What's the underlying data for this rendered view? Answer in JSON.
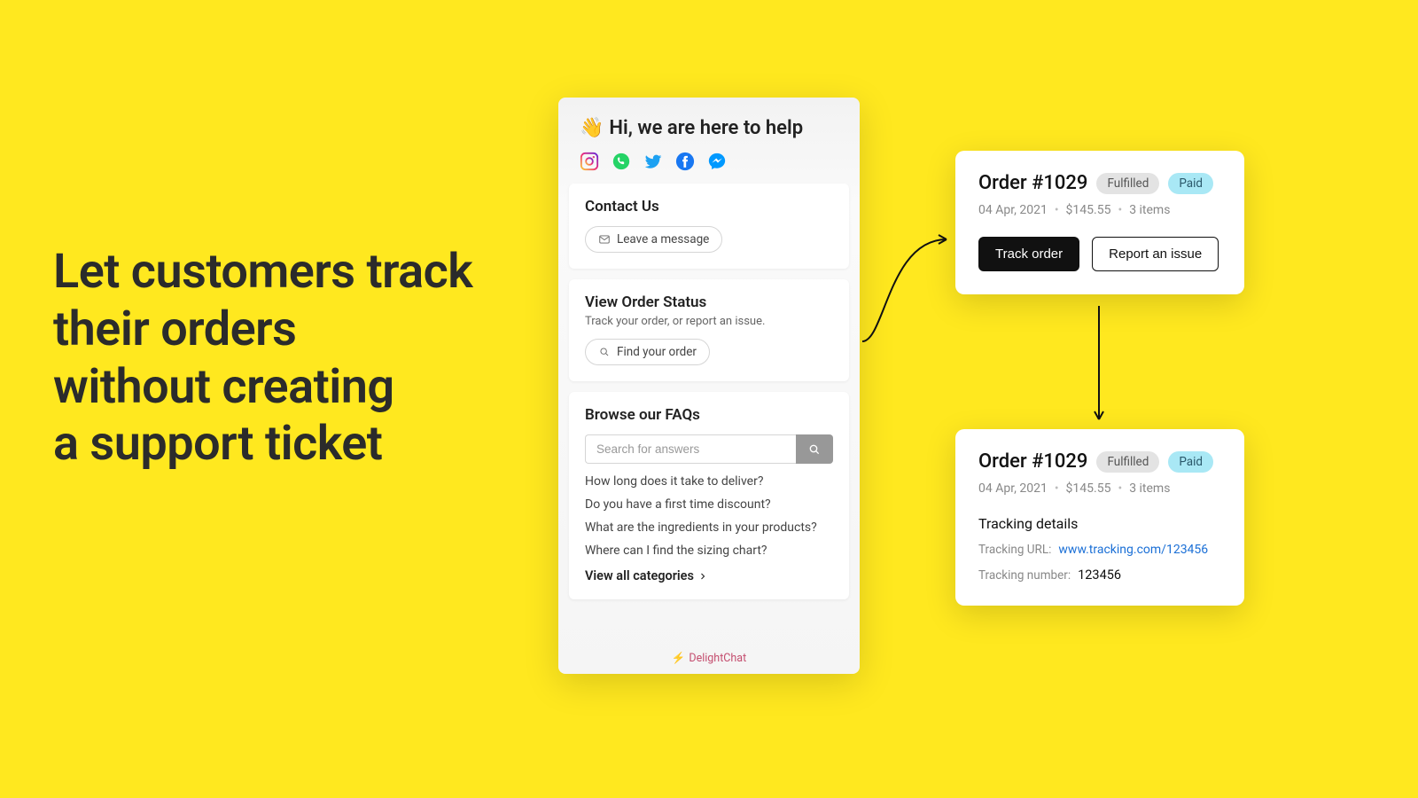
{
  "headline": {
    "l1": "Let customers track",
    "l2": "their orders",
    "l3": "without creating",
    "l4": "a support ticket"
  },
  "widget": {
    "greeting_emoji": "👋",
    "greeting": "Hi, we are here to help",
    "contact": {
      "title": "Contact Us",
      "button": "Leave a message"
    },
    "order_status": {
      "title": "View Order Status",
      "subtitle": "Track your order, or report an issue.",
      "button": "Find your order"
    },
    "faqs": {
      "title": "Browse our FAQs",
      "search_placeholder": "Search for answers",
      "items": [
        "How long does it take to deliver?",
        "Do you have a first time discount?",
        "What are the ingredients in your products?",
        "Where can I find the sizing chart?"
      ],
      "view_all": "View all categories"
    },
    "footer": {
      "brand": "DelightChat"
    }
  },
  "order": {
    "title": "Order #1029",
    "status_fulfilled": "Fulfilled",
    "status_paid": "Paid",
    "date": "04 Apr, 2021",
    "amount": "$145.55",
    "items": "3 items",
    "track_btn": "Track order",
    "report_btn": "Report an issue",
    "tracking": {
      "heading": "Tracking details",
      "url_label": "Tracking URL:",
      "url_value": "www.tracking.com/123456",
      "num_label": "Tracking number:",
      "num_value": "123456"
    }
  }
}
